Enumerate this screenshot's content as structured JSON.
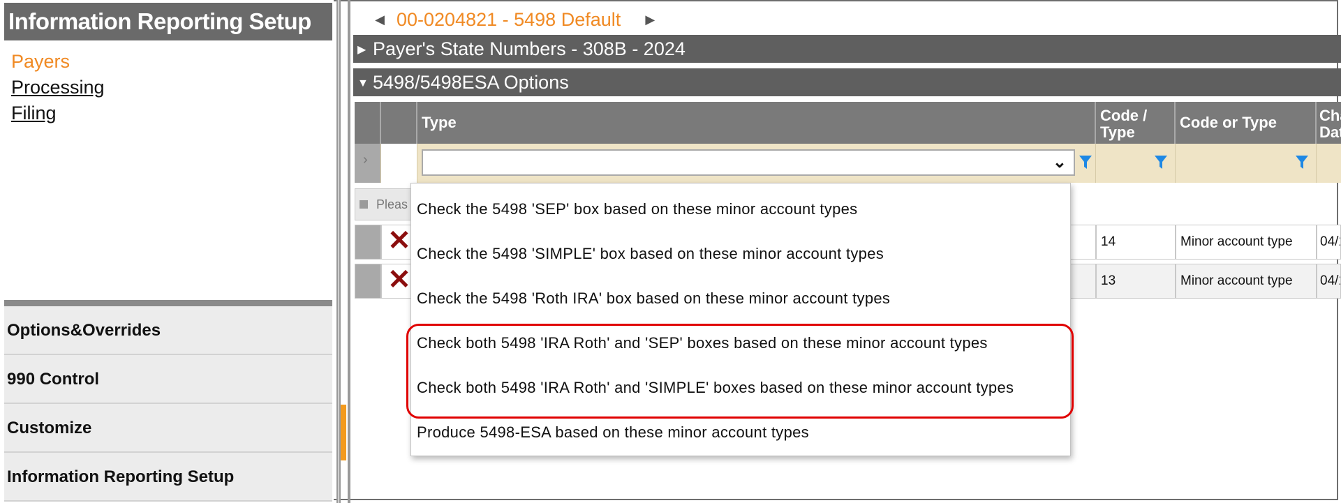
{
  "sidebar": {
    "title": "Information Reporting Setup",
    "links": [
      {
        "label": "Payers",
        "active": true
      },
      {
        "label": "Processing",
        "active": false
      },
      {
        "label": "Filing",
        "active": false
      }
    ],
    "bottom_nav": [
      "Options&Overrides",
      "990 Control",
      "Customize",
      "Information Reporting Setup"
    ]
  },
  "record": {
    "title": "00-0204821 - 5498 Default",
    "prev_icon": "prev-arrow-icon",
    "next_icon": "next-arrow-icon"
  },
  "sections": {
    "state_numbers": "Payer's State Numbers - 308B - 2024",
    "options": "5498/5498ESA Options"
  },
  "grid": {
    "columns": [
      "Type",
      "Code / Type",
      "Code or Type",
      "Cha Dat"
    ],
    "pager_text": "Pleas",
    "rows": [
      {
        "code": "14",
        "code_or_type": "Minor account type",
        "date": "04/1"
      },
      {
        "code": "13",
        "code_or_type": "Minor account type",
        "date": "04/1"
      }
    ]
  },
  "dropdown": {
    "options": [
      "Check the 5498 'SEP' box based on these minor account types",
      "Check the 5498 'SIMPLE' box based on these minor account types",
      "Check the 5498 'Roth IRA' box based on these minor account types",
      "Check both 5498 'IRA Roth' and 'SEP' boxes based on these minor account types",
      "Check both 5498 'IRA Roth' and 'SIMPLE' boxes based on these minor account types",
      "Produce 5498-ESA based on these minor account types"
    ]
  },
  "colors": {
    "accent_orange": "#f08a24",
    "header_gray": "#5f5f5f",
    "filter_bg": "#efe4c6",
    "filter_icon_blue": "#1e88e5",
    "delete_red": "#8b0d0d",
    "highlight_red": "#e00000"
  }
}
